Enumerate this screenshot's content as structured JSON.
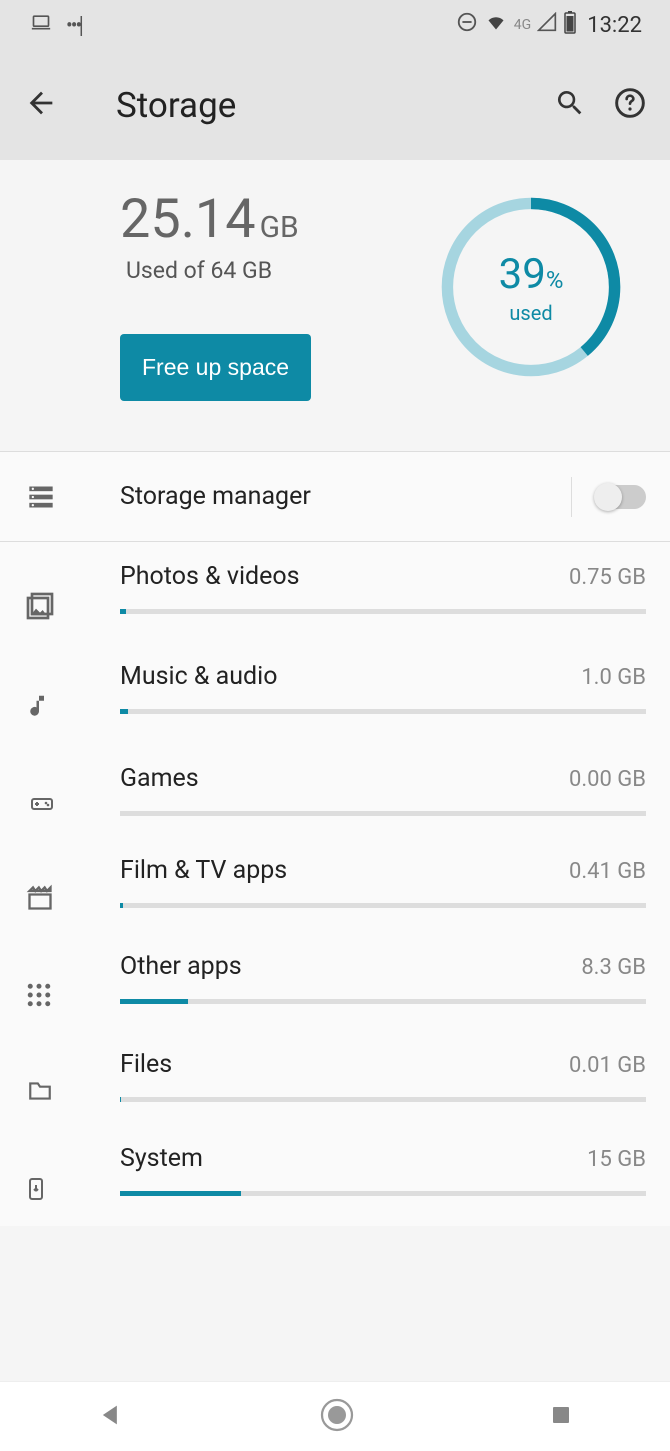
{
  "status": {
    "network": "4G",
    "time": "13:22"
  },
  "header": {
    "title": "Storage"
  },
  "summary": {
    "used_value": "25.14",
    "used_unit": "GB",
    "used_of": "Used of 64 GB",
    "button": "Free up space",
    "ring_value": "39",
    "ring_sign": "%",
    "ring_label": "used",
    "ring_percent": 39
  },
  "manager": {
    "label": "Storage manager",
    "enabled": false
  },
  "categories": [
    {
      "name": "Photos & videos",
      "size": "0.75 GB",
      "pct": 1.2
    },
    {
      "name": "Music & audio",
      "size": "1.0 GB",
      "pct": 1.6
    },
    {
      "name": "Games",
      "size": "0.00 GB",
      "pct": 0
    },
    {
      "name": "Film & TV apps",
      "size": "0.41 GB",
      "pct": 0.6
    },
    {
      "name": "Other apps",
      "size": "8.3 GB",
      "pct": 13
    },
    {
      "name": "Files",
      "size": "0.01 GB",
      "pct": 0.02
    },
    {
      "name": "System",
      "size": "15 GB",
      "pct": 23
    }
  ],
  "icons": {
    "categories": [
      "photo-icon",
      "music-icon",
      "gamepad-icon",
      "film-icon",
      "apps-icon",
      "folder-icon",
      "system-icon"
    ]
  }
}
